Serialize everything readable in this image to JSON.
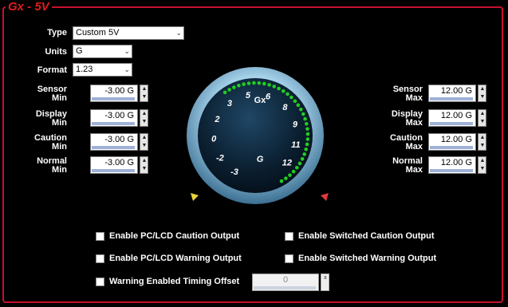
{
  "panel": {
    "title": "Gx - 5V"
  },
  "settings": {
    "type_label": "Type",
    "type_value": "Custom 5V",
    "units_label": "Units",
    "units_value": "G",
    "format_label": "Format",
    "format_value": "1.23"
  },
  "left_fields": [
    {
      "label1": "Sensor",
      "label2": "Min",
      "value": "-3.00 G"
    },
    {
      "label1": "Display",
      "label2": "Min",
      "value": "-3.00 G"
    },
    {
      "label1": "Caution",
      "label2": "Min",
      "value": "-3.00 G"
    },
    {
      "label1": "Normal",
      "label2": "Min",
      "value": "-3.00 G"
    }
  ],
  "right_fields": [
    {
      "label1": "Sensor",
      "label2": "Max",
      "value": "12.00 G"
    },
    {
      "label1": "Display",
      "label2": "Max",
      "value": "12.00 G"
    },
    {
      "label1": "Caution",
      "label2": "Max",
      "value": "12.00 G"
    },
    {
      "label1": "Normal",
      "label2": "Max",
      "value": "12.00 G"
    }
  ],
  "gauge": {
    "name": "Gx",
    "unit": "G",
    "ticks": [
      "-3",
      "-2",
      "0",
      "2",
      "3",
      "5",
      "6",
      "8",
      "9",
      "11",
      "12"
    ],
    "led_color": "#22cc22",
    "min_marker_color": "#e8d23a",
    "max_marker_color": "#e03a3a"
  },
  "options": {
    "pc_lcd_caution": "Enable PC/LCD Caution Output",
    "switched_caution": "Enable Switched Caution Output",
    "pc_lcd_warning": "Enable PC/LCD Warning Output",
    "switched_warning": "Enable Switched Warning Output",
    "timing_offset": "Warning Enabled Timing Offset",
    "timing_offset_value": "0"
  },
  "colors": {
    "accent": "#c8102e",
    "background": "#000000"
  }
}
